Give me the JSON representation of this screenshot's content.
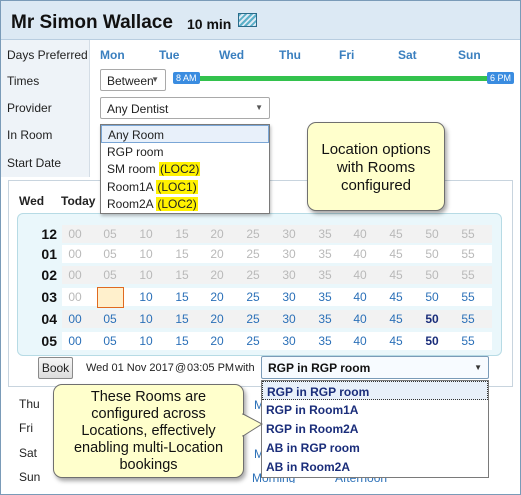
{
  "header": {
    "patient_name": "Mr Simon Wallace",
    "duration": "10 min"
  },
  "labels": {
    "days_preferred": "Days Preferred",
    "times": "Times",
    "provider": "Provider",
    "in_room": "In Room",
    "start_date": "Start Date"
  },
  "days": [
    "Mon",
    "Tue",
    "Wed",
    "Thu",
    "Fri",
    "Sat",
    "Sun"
  ],
  "times": {
    "mode": "Between",
    "start": "8 AM",
    "end": "6 PM"
  },
  "provider": {
    "value": "Any Dentist"
  },
  "room_dropdown": {
    "items": [
      {
        "text": "Any Room",
        "loc": ""
      },
      {
        "text": "RGP room",
        "loc": ""
      },
      {
        "text": "SM room ",
        "loc": "(LOC2)"
      },
      {
        "text": "Room1A ",
        "loc": "(LOC1)"
      },
      {
        "text": "Room2A ",
        "loc": "(LOC2)"
      }
    ]
  },
  "callout_top": {
    "line1": "Location options",
    "line2": "with Rooms",
    "line3": "configured"
  },
  "calendar": {
    "day": "Wed",
    "today": "Today",
    "rows": [
      {
        "hour": "12",
        "slots": [
          "00",
          "05",
          "10",
          "15",
          "20",
          "25",
          "30",
          "35",
          "40",
          "45",
          "50",
          "55"
        ],
        "avail": []
      },
      {
        "hour": "01",
        "slots": [
          "00",
          "05",
          "10",
          "15",
          "20",
          "25",
          "30",
          "35",
          "40",
          "45",
          "50",
          "55"
        ],
        "avail": []
      },
      {
        "hour": "02",
        "slots": [
          "00",
          "05",
          "10",
          "15",
          "20",
          "25",
          "30",
          "35",
          "40",
          "45",
          "50",
          "55"
        ],
        "avail": []
      },
      {
        "hour": "03",
        "slots": [
          "00",
          "05",
          "10",
          "15",
          "20",
          "25",
          "30",
          "35",
          "40",
          "45",
          "50",
          "55"
        ],
        "avail": [
          1,
          2,
          3,
          4,
          5,
          6,
          7,
          8,
          9,
          10,
          11
        ]
      },
      {
        "hour": "04",
        "slots": [
          "00",
          "05",
          "10",
          "15",
          "20",
          "25",
          "30",
          "35",
          "40",
          "45",
          "50",
          "55"
        ],
        "avail": [
          0,
          1,
          2,
          3,
          4,
          5,
          6,
          7,
          8,
          9,
          10,
          11
        ]
      },
      {
        "hour": "05",
        "slots": [
          "00",
          "05",
          "10",
          "15",
          "20",
          "25",
          "30",
          "35",
          "40",
          "45",
          "50",
          "55"
        ],
        "avail": [
          0,
          1,
          2,
          3,
          4,
          5,
          6,
          7,
          8,
          9,
          10,
          11
        ]
      }
    ]
  },
  "booking": {
    "button": "Book",
    "date": "Wed 01 Nov 2017",
    "at": "@",
    "time": "03:05 PM",
    "with": "with",
    "selected_room": "RGP in RGP room"
  },
  "room_options": [
    "RGP in RGP room",
    "RGP in Room1A",
    "RGP in Room2A",
    "AB in RGP room",
    "AB in Room2A"
  ],
  "callout_bottom": {
    "line1": "These Rooms are",
    "line2": "configured across",
    "line3": "Locations, effectively",
    "line4": "enabling multi-Location",
    "line5": "bookings"
  },
  "bottom_days": [
    "Thu",
    "Fri",
    "Sat",
    "Sun"
  ],
  "bottom_fragments": {
    "m1": "M",
    "m2": "M",
    "morning": "Morning",
    "afternoon": "Afternoon"
  }
}
